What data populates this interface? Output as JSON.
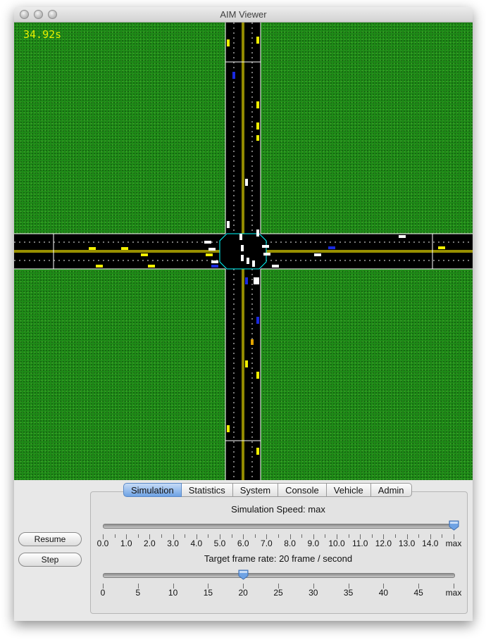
{
  "window": {
    "title": "AIM Viewer"
  },
  "simulation": {
    "timer": "34.92s"
  },
  "buttons": {
    "resume": "Resume",
    "step": "Step"
  },
  "tabs": [
    {
      "label": "Simulation",
      "active": true
    },
    {
      "label": "Statistics",
      "active": false
    },
    {
      "label": "System",
      "active": false
    },
    {
      "label": "Console",
      "active": false
    },
    {
      "label": "Vehicle",
      "active": false
    },
    {
      "label": "Admin",
      "active": false
    }
  ],
  "speed_slider": {
    "label": "Simulation Speed: max",
    "tick_labels": [
      "0.0",
      "1.0",
      "2.0",
      "3.0",
      "4.0",
      "5.0",
      "6.0",
      "7.0",
      "8.0",
      "9.0",
      "10.0",
      "11.0",
      "12.0",
      "13.0",
      "14.0",
      "max"
    ],
    "value_position": 15
  },
  "frame_slider": {
    "label": "Target frame rate: 20 frame / second",
    "tick_labels": [
      "0",
      "5",
      "10",
      "15",
      "20",
      "25",
      "30",
      "35",
      "40",
      "45",
      "max"
    ],
    "value": 20
  },
  "colors": {
    "grass": "#1e8a17",
    "road": "#000000",
    "lane_marking": "#f0f0f0",
    "center_line": "#f2e600",
    "intersection_border": "#00ffff",
    "vehicle_yellow": "#f2f000",
    "vehicle_white": "#ffffff",
    "vehicle_blue": "#1a2ae0"
  }
}
